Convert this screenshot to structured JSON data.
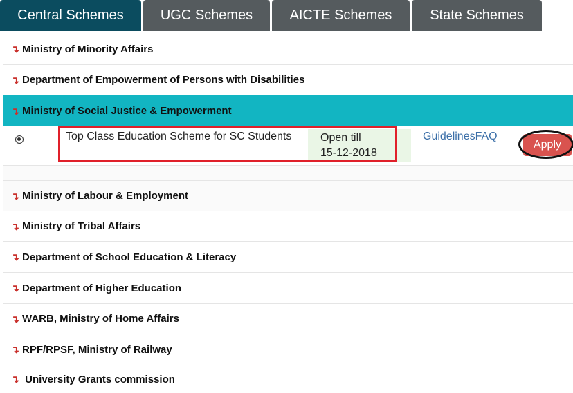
{
  "tabs": [
    {
      "label": "Central Schemes",
      "active": true
    },
    {
      "label": "UGC Schemes"
    },
    {
      "label": "AICTE Schemes"
    },
    {
      "label": "State Schemes"
    }
  ],
  "arrow_glyph": "↴",
  "ministries": [
    {
      "label": "Ministry of Minority Affairs"
    },
    {
      "label": "Department of Empowerment of Persons with Disabilities"
    },
    {
      "label": "Ministry of Social Justice & Empowerment",
      "expanded": true
    },
    {
      "label": "Ministry of Labour & Employment"
    },
    {
      "label": "Ministry of Tribal Affairs"
    },
    {
      "label": "Department of School Education & Literacy"
    },
    {
      "label": "Department of Higher Education"
    },
    {
      "label": "WARB, Ministry of Home Affairs"
    },
    {
      "label": "RPF/RPSF, Ministry of Railway"
    },
    {
      "label": " University Grants commission"
    }
  ],
  "scheme": {
    "name": "Top Class Education Scheme for SC Students",
    "open_till_label": "Open till",
    "open_till_date": "15-12-2018",
    "guidelines_label": "Guidelines",
    "faq_label": "FAQ",
    "apply_label": "Apply"
  },
  "colors": {
    "active_tab": "#0b4c5f",
    "inactive_tab": "#555b5e",
    "expanded_row": "#12b5c2",
    "arrow": "#c9302c",
    "apply_button": "#d9534f",
    "highlight_box": "#e0202a"
  }
}
